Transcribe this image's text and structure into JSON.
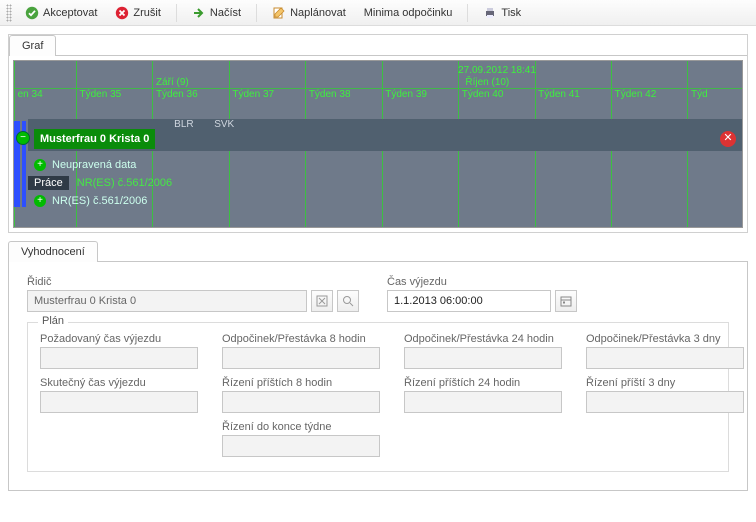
{
  "toolbar": {
    "accept": "Akceptovat",
    "cancel": "Zrušit",
    "load": "Načíst",
    "plan": "Naplánovat",
    "minima": "Minima odpočinku",
    "print": "Tisk"
  },
  "tabs": {
    "graph": "Graf",
    "eval": "Vyhodnocení"
  },
  "graph": {
    "timestamp": "27.09.2012 18:41",
    "months": {
      "sept": "Září (9)",
      "oct": "Říjen (10)"
    },
    "weeks": [
      "en 34",
      "Týden 35",
      "Týden 36",
      "Týden 37",
      "Týden 38",
      "Týden 39",
      "Týden 40",
      "Týden 41",
      "Týden 42",
      "Týd"
    ],
    "driver": "Musterfrau 0 Krista 0",
    "flags": [
      "BLR",
      "SVK"
    ],
    "rows": {
      "unedited": "Neupravená data",
      "work": "Práce",
      "regulation": "NR(ES) č.561/2006",
      "regulation2": "NR(ES) č.561/2006"
    }
  },
  "eval": {
    "driver_label": "Řidič",
    "driver_value": "Musterfrau 0 Krista 0",
    "time_label": "Čas výjezdu",
    "time_value": "1.1.2013 06:00:00",
    "plan_label": "Plán",
    "fields": {
      "requested": "Požadovaný čas výjezdu",
      "rest8": "Odpočinek/Přestávka 8 hodin",
      "rest24": "Odpočinek/Přestávka 24 hodin",
      "rest3d": "Odpočinek/Přestávka 3 dny",
      "actual": "Skutečný čas výjezdu",
      "drive8": "Řízení příštích 8 hodin",
      "drive24": "Řízení příštích 24 hodin",
      "drive3d": "Řízení příští 3 dny",
      "drive_eow": "Řízení do konce týdne"
    }
  }
}
